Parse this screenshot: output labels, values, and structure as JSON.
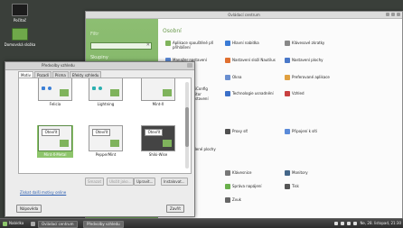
{
  "desktop": {
    "icons": [
      {
        "label": "Počítač"
      },
      {
        "label": "Domovská složka"
      }
    ]
  },
  "control_center": {
    "title": "Ovládací centrum",
    "sidebar": {
      "filter_label": "Filtr",
      "search_value": "",
      "search_clear": "✕",
      "groups_label": "Skupiny"
    },
    "section_title": "Osobní",
    "items": [
      {
        "label": "Aplikace spouštěné při přihlášení",
        "color": "#7fb35c"
      },
      {
        "label": "Hlavní nabídka",
        "color": "#3a7bd5"
      },
      {
        "label": "Klávesové zkratky",
        "color": "#888888"
      },
      {
        "label": "Manažer nastavení Compizu",
        "color": "#5c8ad6"
      },
      {
        "label": "Nastavení složí Nautilus",
        "color": "#e07030"
      },
      {
        "label": "Nastavení plochy",
        "color": "#4a78c8"
      },
      {
        "label": "Okna",
        "color": "#6a8fd0"
      },
      {
        "label": "Preferované aplikace",
        "color": "#e0a040"
      },
      {
        "label": "Technologie usnadnění",
        "color": "#3a6fc8"
      },
      {
        "label": "Vzhled",
        "color": "#c84040"
      },
      {
        "label": "Proxy síť",
        "color": "#505050"
      },
      {
        "label": "Připojení k síti",
        "color": "#5a8ad8"
      },
      {
        "label": "Klávesnice",
        "color": "#777777"
      },
      {
        "label": "Monitory",
        "color": "#446688"
      },
      {
        "label": "Správa napájení",
        "color": "#6ab04c"
      },
      {
        "label": "Tisk",
        "color": "#555555"
      },
      {
        "label": "Zvuk",
        "color": "#666666"
      }
    ],
    "partial_texts": [
      "apiConfig",
      "Editor nastavení",
      "celené plochy"
    ]
  },
  "theme_dialog": {
    "title": "Předvolby vzhledu",
    "tabs": [
      "Motiv",
      "Pozadí",
      "Písma",
      "Efekty vzhledu"
    ],
    "active_tab": "Motiv",
    "themes": [
      {
        "name": "Felicia"
      },
      {
        "name": "Lightning"
      },
      {
        "name": "Mint-X"
      },
      {
        "name": "Mint-X-Metal",
        "selected": true
      },
      {
        "name": "PepperMint"
      },
      {
        "name": "Shiki-Wise"
      }
    ],
    "preview_entry_text": "Otevřít",
    "buttons": {
      "customize": "Upravit...",
      "install": "Instalovat...",
      "delete": "Smazat",
      "save_as": "Uložit jako..."
    },
    "link": "Získat další motivy online",
    "help": "Nápověda",
    "close": "Zavřít"
  },
  "taskbar": {
    "menu": "Nabídka",
    "windows": [
      "Ovládací centrum",
      "Předvolby vzhledu"
    ],
    "clock": "Ne, 28. listopad, 21:30"
  }
}
